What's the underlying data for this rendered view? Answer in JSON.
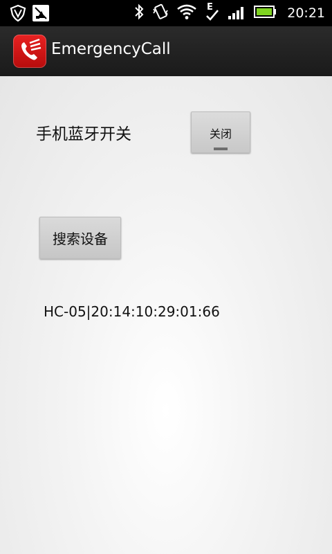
{
  "status_bar": {
    "time": "20:21",
    "icons": [
      "vpn-shield-icon",
      "notification-icon",
      "bluetooth-icon",
      "vibrate-icon",
      "wifi-icon",
      "edge-data-icon",
      "signal-icon",
      "battery-icon"
    ]
  },
  "action_bar": {
    "title": "EmergencyCall",
    "icon": "emergency-call-app-icon",
    "brand_color": "#d81818"
  },
  "main": {
    "bluetooth_label": "手机蓝牙开关",
    "bluetooth_toggle": "关闭",
    "search_button": "搜索设备",
    "devices": [
      "HC-05|20:14:10:29:01:66"
    ]
  }
}
